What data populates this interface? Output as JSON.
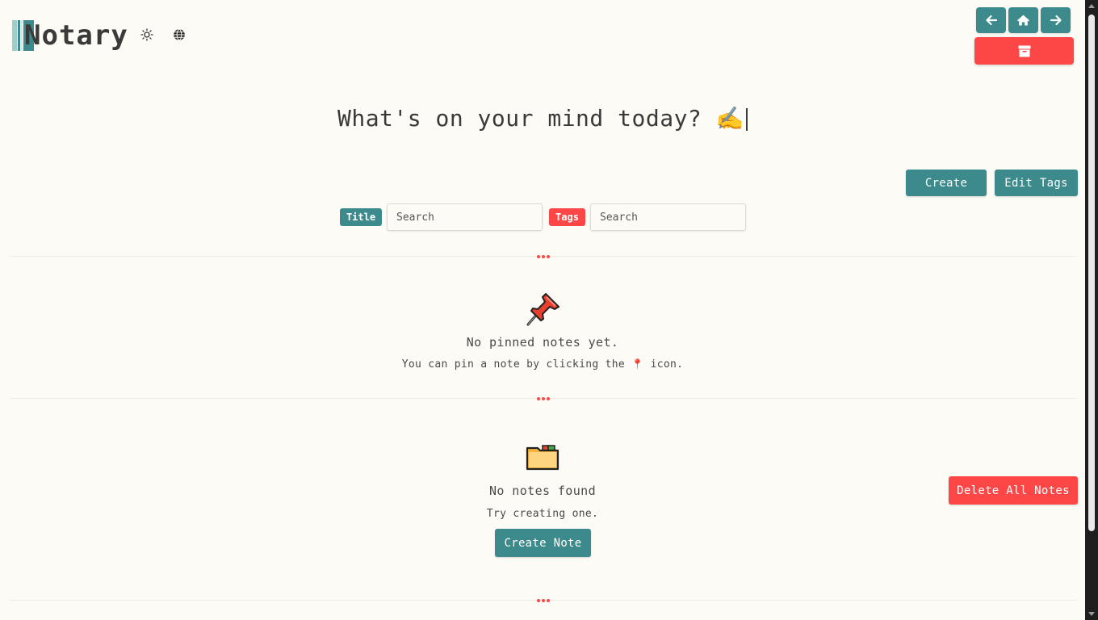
{
  "app": {
    "name": "Notary"
  },
  "header": {
    "theme_icon": "sun-icon",
    "language_icon": "globe-icon"
  },
  "nav": {
    "back_icon": "arrow-left-icon",
    "home_icon": "home-icon",
    "forward_icon": "arrow-right-icon",
    "archive_icon": "archive-box-icon"
  },
  "hero": {
    "headline": "What's on your mind today? ✍️"
  },
  "actions": {
    "create_label": "Create",
    "edit_tags_label": "Edit Tags",
    "delete_all_label": "Delete All Notes"
  },
  "search": {
    "title_label": "Title",
    "title_placeholder": "Search",
    "tags_label": "Tags",
    "tags_placeholder": "Search"
  },
  "pinned": {
    "icon": "pushpin-icon",
    "empty_title": "No pinned notes yet.",
    "hint_before": "You can pin a note by clicking the",
    "hint_icon": "📍",
    "hint_after": "icon."
  },
  "notes": {
    "icon": "folder-icon",
    "empty_title": "No notes found",
    "empty_hint": "Try creating one.",
    "create_note_label": "Create Note"
  },
  "colors": {
    "accent": "#3d8a8c",
    "danger": "#fd4747",
    "background": "#fdfbf6",
    "text": "#3a3a3a"
  }
}
